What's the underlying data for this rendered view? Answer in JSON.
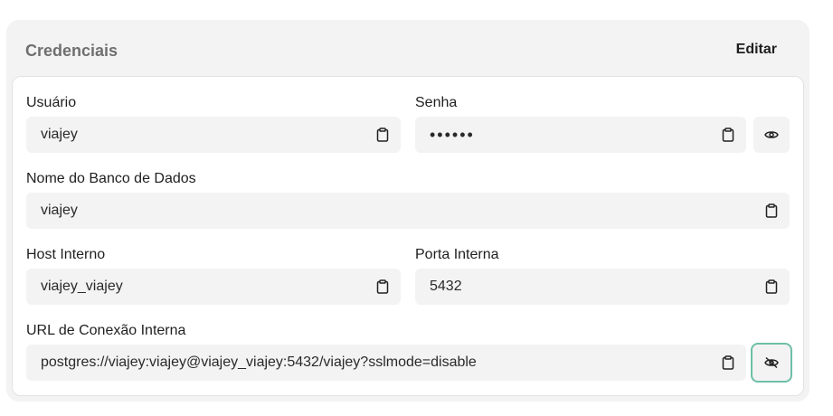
{
  "card": {
    "title": "Credenciais",
    "edit_label": "Editar"
  },
  "fields": {
    "usuario": {
      "label": "Usuário",
      "value": "viajey"
    },
    "senha": {
      "label": "Senha",
      "value": "••••••"
    },
    "banco": {
      "label": "Nome do Banco de Dados",
      "value": "viajey"
    },
    "host": {
      "label": "Host Interno",
      "value": "viajey_viajey"
    },
    "porta": {
      "label": "Porta Interna",
      "value": "5432"
    },
    "url": {
      "label": "URL de Conexão Interna",
      "value": "postgres://viajey:viajey@viajey_viajey:5432/viajey?sslmode=disable"
    }
  },
  "icons": {
    "copy": "clipboard-icon",
    "show": "eye-icon",
    "hide": "eye-off-icon"
  },
  "colors": {
    "focus_ring": "#6fbfa7"
  }
}
